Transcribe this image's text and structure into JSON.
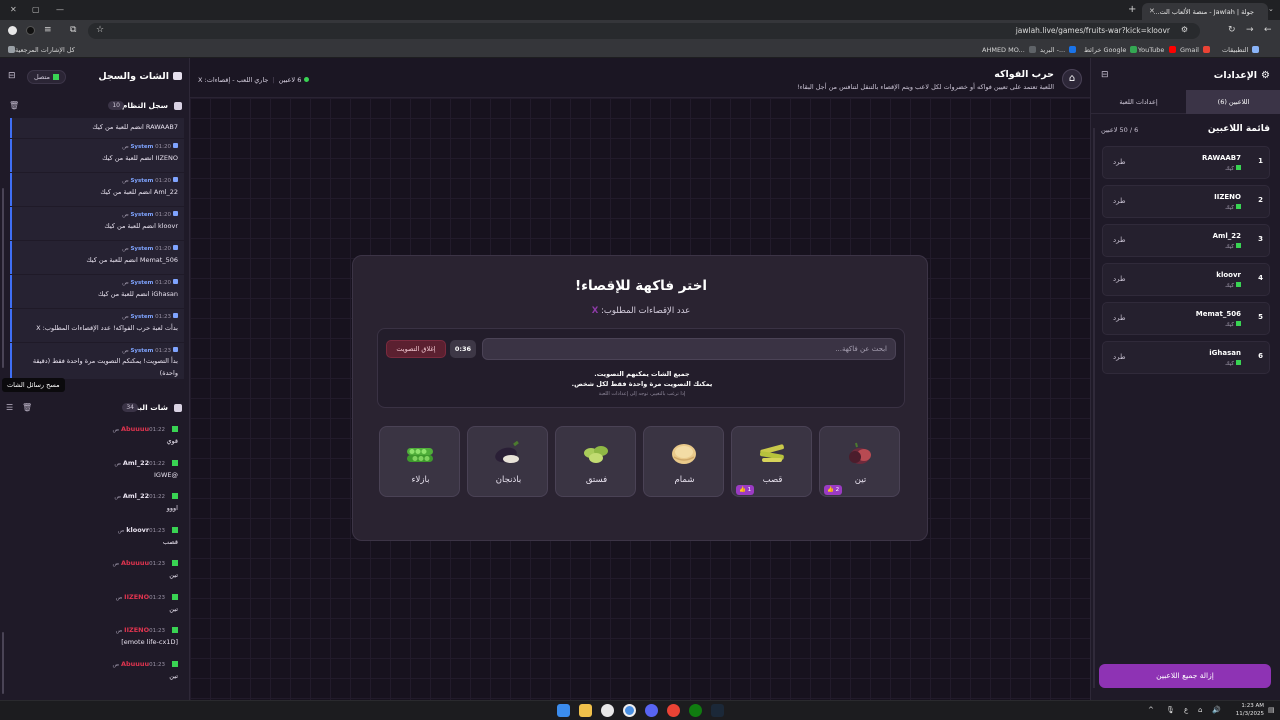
{
  "browser": {
    "tab_title": "جولة | Jawlah - منصة الألعاب الت...",
    "url": "jawlah.live/games/fruits-war?kick=kloovr",
    "bookmarks": [
      "التطبيقات",
      "Gmail",
      "YouTube",
      "خرائط Google",
      "البريد -...",
      "AHMED MO..."
    ],
    "all_bookmarks": "كل الإشارات المرجعية"
  },
  "left_panel": {
    "title": "الشات والسجل",
    "connection": "متصل",
    "system_log": {
      "title": "سجل النظام",
      "count": "10",
      "entries": [
        {
          "sender": "",
          "time": "",
          "message": "RAWAAB7 انضم للعبة من كيك"
        },
        {
          "sender": "System",
          "time": "01:20 ص",
          "message": "IIZENO انضم للعبة من كيك"
        },
        {
          "sender": "System",
          "time": "01:20 ص",
          "message": "Aml_22 انضم للعبة من كيك"
        },
        {
          "sender": "System",
          "time": "01:20 ص",
          "message": "kloovr انضم للعبة من كيك"
        },
        {
          "sender": "System",
          "time": "01:20 ص",
          "message": "Memat_506 انضم للعبة من كيك"
        },
        {
          "sender": "System",
          "time": "01:20 ص",
          "message": "iGhasan انضم للعبة من كيك"
        },
        {
          "sender": "System",
          "time": "01:23 ص",
          "message": "بدأت لعبة حرب الفواكه! عدد الإقصاءات المطلوب: X"
        },
        {
          "sender": "System",
          "time": "01:23 ص",
          "message": "بدأ التصويت! يمكنكم التصويت مرة واحدة فقط (دقيقة واحدة)"
        }
      ]
    },
    "tooltip": "مسح رسائل الشات",
    "live_chat": {
      "title": "شات البث",
      "count": "34",
      "messages": [
        {
          "user": "Abuuuu",
          "time": "01:22 ص",
          "text": "قوي",
          "color": "#e0344f"
        },
        {
          "user": "Aml_22",
          "time": "01:22 ص",
          "text": "@IGWE",
          "color": "#e8e2ef"
        },
        {
          "user": "Aml_22",
          "time": "01:22 ص",
          "text": "اووو",
          "color": "#e8e2ef"
        },
        {
          "user": "kloovr",
          "time": "01:23 ص",
          "text": "قصب",
          "color": "#e8e2ef"
        },
        {
          "user": "Abuuuu",
          "time": "01:23 ص",
          "text": "تين",
          "color": "#e0344f"
        },
        {
          "user": "IIZENO",
          "time": "01:23 ص",
          "text": "تين",
          "color": "#e0344f"
        },
        {
          "user": "IIZENO",
          "time": "01:23 ص",
          "text": "[emote life-cx1D]",
          "color": "#e0344f"
        },
        {
          "user": "Abuuuu",
          "time": "01:23 ص",
          "text": "تين",
          "color": "#e0344f"
        }
      ]
    }
  },
  "center": {
    "game_title": "حرب الفواكه",
    "game_subtitle": "اللعبة تعتمد على تعيين فواكه أو خضروات لكل لاعب ويتم الإقصاء بالتنقل لتنافس من أجل البقاء!",
    "status_players": "6 لاعبين",
    "status_phase": "جاري اللعب - إقصاءات: X",
    "card": {
      "title": "اختر فاكهة للإقصاء!",
      "subtitle_prefix": "عدد الإقصاءات المطلوب:",
      "subtitle_value": "X",
      "search_placeholder": "ابحث عن فاكهة...",
      "timer": "0:36",
      "close_voting": "إغلاق التصويت",
      "note_line1": "جميع الشات يمكنهم التصويت.",
      "note_line2": "يمكنك التصويت مرة واحدة فقط لكل شخص.",
      "hint": "إذا ترغب بالتغيير، توجه إلى إعدادات اللعبة"
    },
    "fruits": [
      {
        "name": "تين",
        "votes": "2"
      },
      {
        "name": "قصب",
        "votes": "1"
      },
      {
        "name": "شمام",
        "votes": ""
      },
      {
        "name": "فستق",
        "votes": ""
      },
      {
        "name": "باذنجان",
        "votes": ""
      },
      {
        "name": "بازلاء",
        "votes": ""
      }
    ]
  },
  "right_panel": {
    "title": "الإعدادات",
    "tabs": [
      "اللاعبين (6)",
      "إعدادات اللعبة"
    ],
    "players_title": "قائمة اللاعبين",
    "players_count": "6 / 50 لاعبين",
    "kick_label": "طرد",
    "platform_label": "كيك",
    "players": [
      {
        "num": "1",
        "name": "RAWAAB7"
      },
      {
        "num": "2",
        "name": "IIZENO"
      },
      {
        "num": "3",
        "name": "Aml_22"
      },
      {
        "num": "4",
        "name": "kloovr"
      },
      {
        "num": "5",
        "name": "Memat_506"
      },
      {
        "num": "6",
        "name": "iGhasan"
      }
    ],
    "remove_all": "إزالة جميع اللاعبين"
  },
  "taskbar": {
    "time": "1:23 AM",
    "date": "11/3/2025",
    "lang": "ع"
  }
}
